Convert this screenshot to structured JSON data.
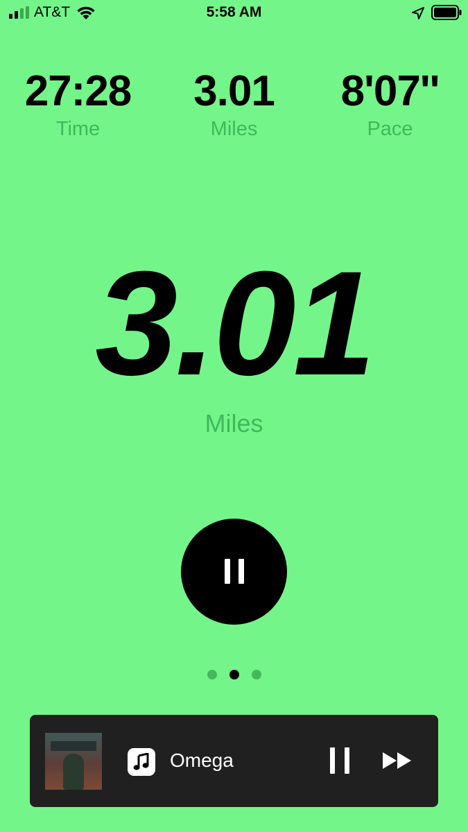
{
  "status_bar": {
    "carrier": "AT&T",
    "time": "5:58 AM"
  },
  "stats": [
    {
      "value": "27:28",
      "label": "Time"
    },
    {
      "value": "3.01",
      "label": "Miles"
    },
    {
      "value": "8'07''",
      "label": "Pace"
    }
  ],
  "main": {
    "distance": "3.01",
    "unit": "Miles"
  },
  "pager": {
    "count": 3,
    "active_index": 1
  },
  "now_playing": {
    "track": "Omega"
  },
  "colors": {
    "background": "#74f58a",
    "label": "#3fb85a",
    "player_bg": "#202020"
  }
}
